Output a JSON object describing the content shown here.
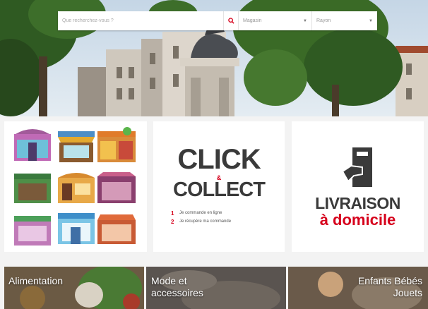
{
  "search": {
    "placeholder": "Que recherchez-vous ?",
    "store_select": "Magasin",
    "category_select": "Rayon"
  },
  "icons": {
    "search": "search-icon",
    "chevron": "chevron-down-icon",
    "delivery": "door-box-icon"
  },
  "colors": {
    "accent": "#d6001c",
    "dark_text": "#3a3a3a"
  },
  "click_collect": {
    "word1": "CLICK",
    "ampersand": "&",
    "word2": "COLLECT",
    "steps": [
      {
        "num": "1",
        "text": "Je commande en ligne"
      },
      {
        "num": "2",
        "text": "Je récupère ma commande"
      }
    ]
  },
  "livraison": {
    "title": "LIVRAISON",
    "subtitle": "à domicile"
  },
  "categories": [
    {
      "label": "Alimentation"
    },
    {
      "label": "Mode et accessoires"
    },
    {
      "label": "Enfants Bébés Jouets"
    }
  ]
}
